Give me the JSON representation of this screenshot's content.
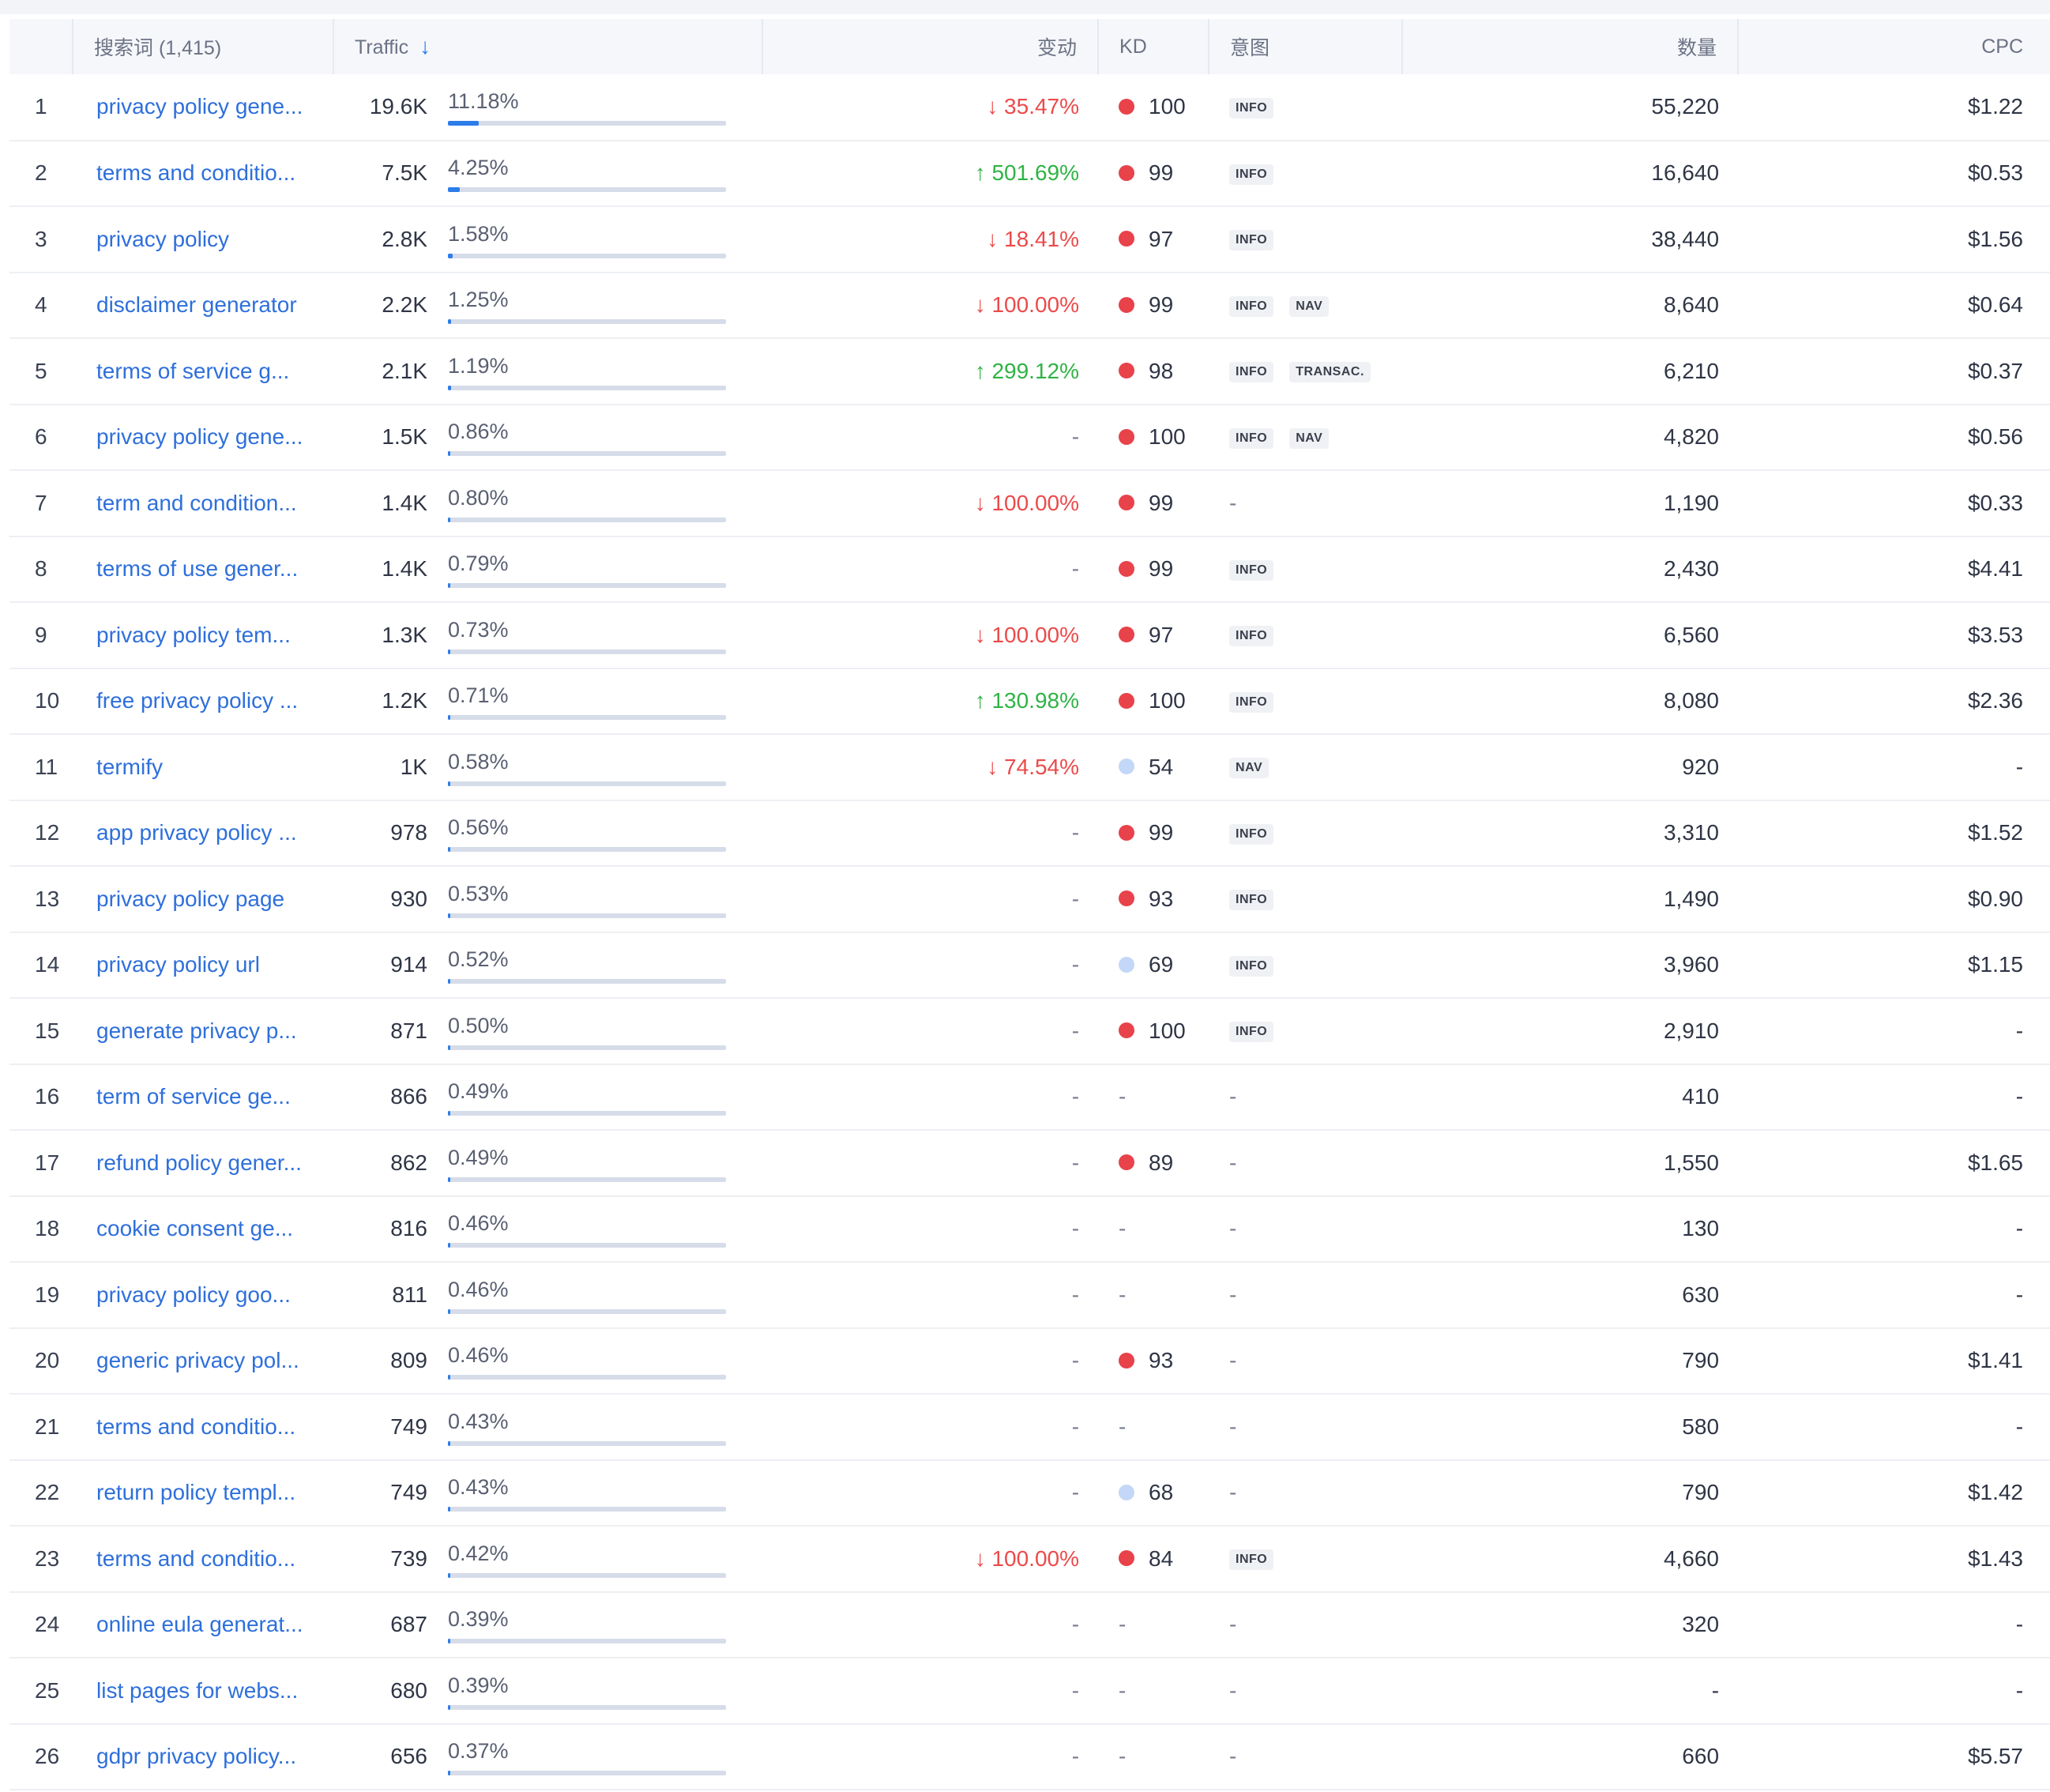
{
  "headers": {
    "keyword": "搜索词 (1,415)",
    "traffic": "Traffic",
    "change": "变动",
    "kd": "KD",
    "intent": "意图",
    "volume": "数量",
    "cpc": "CPC"
  },
  "colors": {
    "kd_hard": "#e8424a",
    "kd_easy": "#c3d7f7",
    "up": "#2fb344",
    "down": "#ec4a4a",
    "bar": "#2b7de9"
  },
  "rows": [
    {
      "n": "1",
      "kw": "privacy policy gene...",
      "traffic": "19.6K",
      "share": "11.18%",
      "share_pct": 11.18,
      "change": "↓ 35.47%",
      "dir": "down",
      "kd": "100",
      "kd_level": "hard",
      "intents": [
        "INFO"
      ],
      "volume": "55,220",
      "cpc": "$1.22"
    },
    {
      "n": "2",
      "kw": "terms and conditio...",
      "traffic": "7.5K",
      "share": "4.25%",
      "share_pct": 4.25,
      "change": "↑ 501.69%",
      "dir": "up",
      "kd": "99",
      "kd_level": "hard",
      "intents": [
        "INFO"
      ],
      "volume": "16,640",
      "cpc": "$0.53"
    },
    {
      "n": "3",
      "kw": "privacy policy",
      "traffic": "2.8K",
      "share": "1.58%",
      "share_pct": 1.58,
      "change": "↓ 18.41%",
      "dir": "down",
      "kd": "97",
      "kd_level": "hard",
      "intents": [
        "INFO"
      ],
      "volume": "38,440",
      "cpc": "$1.56"
    },
    {
      "n": "4",
      "kw": "disclaimer generator",
      "traffic": "2.2K",
      "share": "1.25%",
      "share_pct": 1.25,
      "change": "↓ 100.00%",
      "dir": "down",
      "kd": "99",
      "kd_level": "hard",
      "intents": [
        "INFO",
        "NAV"
      ],
      "volume": "8,640",
      "cpc": "$0.64"
    },
    {
      "n": "5",
      "kw": "terms of service g...",
      "traffic": "2.1K",
      "share": "1.19%",
      "share_pct": 1.19,
      "change": "↑ 299.12%",
      "dir": "up",
      "kd": "98",
      "kd_level": "hard",
      "intents": [
        "INFO",
        "TRANSAC."
      ],
      "volume": "6,210",
      "cpc": "$0.37"
    },
    {
      "n": "6",
      "kw": "privacy policy gene...",
      "traffic": "1.5K",
      "share": "0.86%",
      "share_pct": 0.86,
      "change": "-",
      "dir": "none",
      "kd": "100",
      "kd_level": "hard",
      "intents": [
        "INFO",
        "NAV"
      ],
      "volume": "4,820",
      "cpc": "$0.56"
    },
    {
      "n": "7",
      "kw": "term and condition...",
      "traffic": "1.4K",
      "share": "0.80%",
      "share_pct": 0.8,
      "change": "↓ 100.00%",
      "dir": "down",
      "kd": "99",
      "kd_level": "hard",
      "intents": [],
      "volume": "1,190",
      "cpc": "$0.33"
    },
    {
      "n": "8",
      "kw": "terms of use gener...",
      "traffic": "1.4K",
      "share": "0.79%",
      "share_pct": 0.79,
      "change": "-",
      "dir": "none",
      "kd": "99",
      "kd_level": "hard",
      "intents": [
        "INFO"
      ],
      "volume": "2,430",
      "cpc": "$4.41"
    },
    {
      "n": "9",
      "kw": "privacy policy tem...",
      "traffic": "1.3K",
      "share": "0.73%",
      "share_pct": 0.73,
      "change": "↓ 100.00%",
      "dir": "down",
      "kd": "97",
      "kd_level": "hard",
      "intents": [
        "INFO"
      ],
      "volume": "6,560",
      "cpc": "$3.53"
    },
    {
      "n": "10",
      "kw": "free privacy policy ...",
      "traffic": "1.2K",
      "share": "0.71%",
      "share_pct": 0.71,
      "change": "↑ 130.98%",
      "dir": "up",
      "kd": "100",
      "kd_level": "hard",
      "intents": [
        "INFO"
      ],
      "volume": "8,080",
      "cpc": "$2.36"
    },
    {
      "n": "11",
      "kw": "termify",
      "traffic": "1K",
      "share": "0.58%",
      "share_pct": 0.58,
      "change": "↓ 74.54%",
      "dir": "down",
      "kd": "54",
      "kd_level": "easy",
      "intents": [
        "NAV"
      ],
      "volume": "920",
      "cpc": "-"
    },
    {
      "n": "12",
      "kw": "app privacy policy ...",
      "traffic": "978",
      "share": "0.56%",
      "share_pct": 0.56,
      "change": "-",
      "dir": "none",
      "kd": "99",
      "kd_level": "hard",
      "intents": [
        "INFO"
      ],
      "volume": "3,310",
      "cpc": "$1.52"
    },
    {
      "n": "13",
      "kw": "privacy policy page",
      "traffic": "930",
      "share": "0.53%",
      "share_pct": 0.53,
      "change": "-",
      "dir": "none",
      "kd": "93",
      "kd_level": "hard",
      "intents": [
        "INFO"
      ],
      "volume": "1,490",
      "cpc": "$0.90"
    },
    {
      "n": "14",
      "kw": "privacy policy url",
      "traffic": "914",
      "share": "0.52%",
      "share_pct": 0.52,
      "change": "-",
      "dir": "none",
      "kd": "69",
      "kd_level": "easy",
      "intents": [
        "INFO"
      ],
      "volume": "3,960",
      "cpc": "$1.15"
    },
    {
      "n": "15",
      "kw": "generate privacy p...",
      "traffic": "871",
      "share": "0.50%",
      "share_pct": 0.5,
      "change": "-",
      "dir": "none",
      "kd": "100",
      "kd_level": "hard",
      "intents": [
        "INFO"
      ],
      "volume": "2,910",
      "cpc": "-"
    },
    {
      "n": "16",
      "kw": "term of service ge...",
      "traffic": "866",
      "share": "0.49%",
      "share_pct": 0.49,
      "change": "-",
      "dir": "none",
      "kd": "-",
      "kd_level": "none",
      "intents": [],
      "volume": "410",
      "cpc": "-"
    },
    {
      "n": "17",
      "kw": "refund policy gener...",
      "traffic": "862",
      "share": "0.49%",
      "share_pct": 0.49,
      "change": "-",
      "dir": "none",
      "kd": "89",
      "kd_level": "hard",
      "intents": [],
      "volume": "1,550",
      "cpc": "$1.65"
    },
    {
      "n": "18",
      "kw": "cookie consent ge...",
      "traffic": "816",
      "share": "0.46%",
      "share_pct": 0.46,
      "change": "-",
      "dir": "none",
      "kd": "-",
      "kd_level": "none",
      "intents": [],
      "volume": "130",
      "cpc": "-"
    },
    {
      "n": "19",
      "kw": "privacy policy goo...",
      "traffic": "811",
      "share": "0.46%",
      "share_pct": 0.46,
      "change": "-",
      "dir": "none",
      "kd": "-",
      "kd_level": "none",
      "intents": [],
      "volume": "630",
      "cpc": "-"
    },
    {
      "n": "20",
      "kw": "generic privacy pol...",
      "traffic": "809",
      "share": "0.46%",
      "share_pct": 0.46,
      "change": "-",
      "dir": "none",
      "kd": "93",
      "kd_level": "hard",
      "intents": [],
      "volume": "790",
      "cpc": "$1.41"
    },
    {
      "n": "21",
      "kw": "terms and conditio...",
      "traffic": "749",
      "share": "0.43%",
      "share_pct": 0.43,
      "change": "-",
      "dir": "none",
      "kd": "-",
      "kd_level": "none",
      "intents": [],
      "volume": "580",
      "cpc": "-"
    },
    {
      "n": "22",
      "kw": "return policy templ...",
      "traffic": "749",
      "share": "0.43%",
      "share_pct": 0.43,
      "change": "-",
      "dir": "none",
      "kd": "68",
      "kd_level": "easy",
      "intents": [],
      "volume": "790",
      "cpc": "$1.42"
    },
    {
      "n": "23",
      "kw": "terms and conditio...",
      "traffic": "739",
      "share": "0.42%",
      "share_pct": 0.42,
      "change": "↓ 100.00%",
      "dir": "down",
      "kd": "84",
      "kd_level": "hard",
      "intents": [
        "INFO"
      ],
      "volume": "4,660",
      "cpc": "$1.43"
    },
    {
      "n": "24",
      "kw": "online eula generat...",
      "traffic": "687",
      "share": "0.39%",
      "share_pct": 0.39,
      "change": "-",
      "dir": "none",
      "kd": "-",
      "kd_level": "none",
      "intents": [],
      "volume": "320",
      "cpc": "-"
    },
    {
      "n": "25",
      "kw": "list pages for webs...",
      "traffic": "680",
      "share": "0.39%",
      "share_pct": 0.39,
      "change": "-",
      "dir": "none",
      "kd": "-",
      "kd_level": "none",
      "intents": [],
      "volume": "-",
      "cpc": "-"
    },
    {
      "n": "26",
      "kw": "gdpr privacy policy...",
      "traffic": "656",
      "share": "0.37%",
      "share_pct": 0.37,
      "change": "-",
      "dir": "none",
      "kd": "-",
      "kd_level": "none",
      "intents": [],
      "volume": "660",
      "cpc": "$5.57"
    }
  ]
}
